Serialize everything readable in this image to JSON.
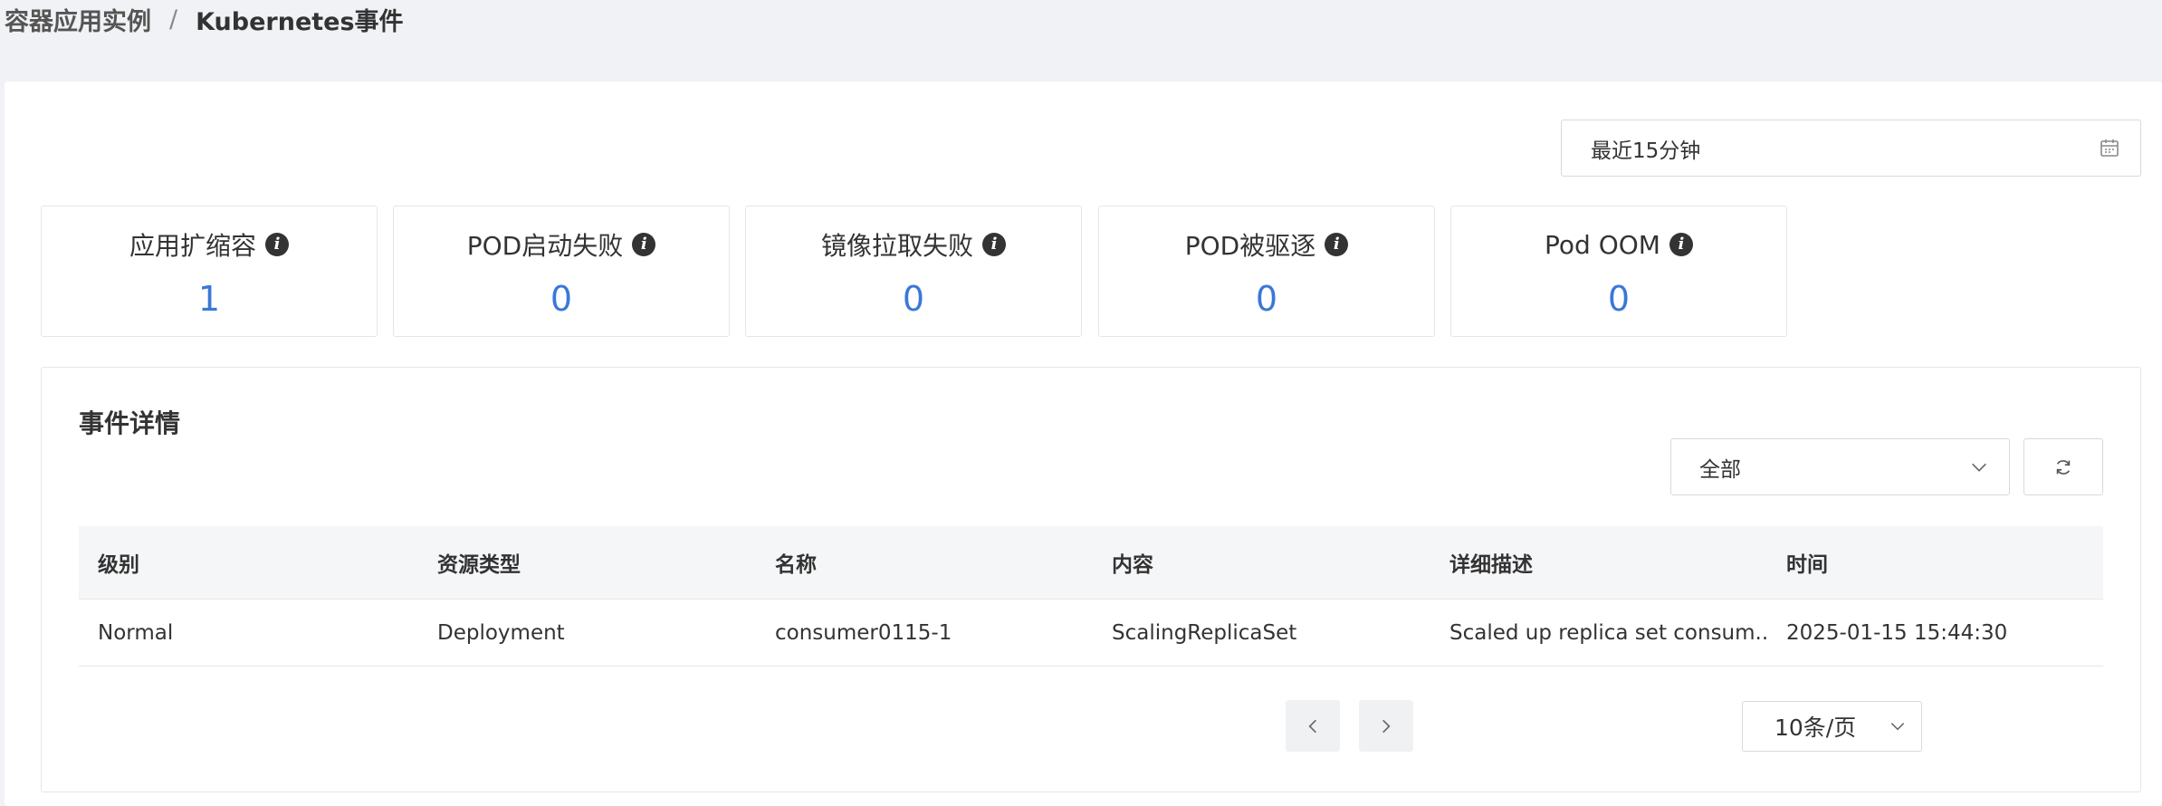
{
  "breadcrumb": {
    "parent": "容器应用实例",
    "separator": "/",
    "current": "Kubernetes事件"
  },
  "time_range": {
    "value": "最近15分钟",
    "icon": "calendar-icon"
  },
  "stats": [
    {
      "label": "应用扩缩容",
      "value": "1",
      "icon": "info-icon"
    },
    {
      "label": "POD启动失败",
      "value": "0",
      "icon": "info-icon"
    },
    {
      "label": "镜像拉取失败",
      "value": "0",
      "icon": "info-icon"
    },
    {
      "label": "POD被驱逐",
      "value": "0",
      "icon": "info-icon"
    },
    {
      "label": "Pod OOM",
      "value": "0",
      "icon": "info-icon"
    }
  ],
  "events": {
    "title": "事件详情",
    "filter": {
      "selected": "全部",
      "icon": "chevron-down-icon"
    },
    "refresh_icon": "refresh-icon",
    "columns": [
      "级别",
      "资源类型",
      "名称",
      "内容",
      "详细描述",
      "时间"
    ],
    "rows": [
      [
        "Normal",
        "Deployment",
        "consumer0115-1",
        "ScalingReplicaSet",
        "Scaled up replica set consum...",
        "2025-01-15 15:44:30"
      ]
    ]
  },
  "pagination": {
    "page_size": "10条/页",
    "prev_icon": "chevron-left-icon",
    "next_icon": "chevron-right-icon"
  },
  "colors": {
    "accent": "#3a78d8",
    "background": "#f0f2f5",
    "header_row": "#f5f6f8"
  }
}
